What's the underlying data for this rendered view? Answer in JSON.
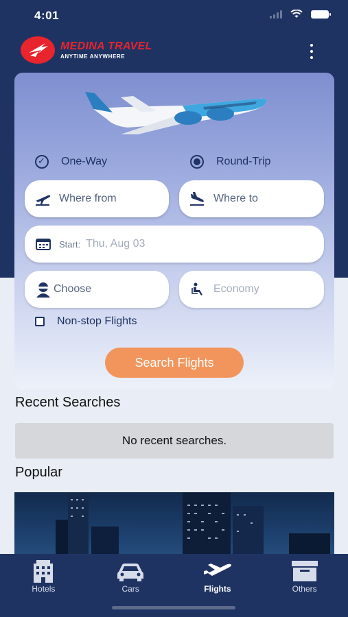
{
  "status_bar": {
    "time": "4:01"
  },
  "brand": {
    "name": "MEDINA TRAVEL",
    "tagline": "ANYTIME ANYWHERE",
    "accent": "#e8242c",
    "navy": "#1f3363"
  },
  "search": {
    "trip_types": [
      {
        "label": "One-Way",
        "icon": "check-circle-icon"
      },
      {
        "label": "Round-Trip",
        "icon": "radio-selected-icon"
      }
    ],
    "from_placeholder": "Where from",
    "to_placeholder": "Where to",
    "start_label": "Start:",
    "start_placeholder": "Thu, Aug 03",
    "passengers_placeholder": "Choose",
    "class_placeholder": "Economy",
    "nonstop_label": "Non-stop Flights",
    "submit_label": "Search Flights",
    "button_color": "#f2955c"
  },
  "recent": {
    "title": "Recent Searches",
    "empty_text": "No recent searches."
  },
  "popular": {
    "title": "Popular"
  },
  "tabs": [
    {
      "label": "Hotels",
      "icon": "hotel-icon"
    },
    {
      "label": "Cars",
      "icon": "car-icon"
    },
    {
      "label": "Flights",
      "icon": "plane-icon",
      "active": true
    },
    {
      "label": "Others",
      "icon": "box-icon"
    }
  ]
}
